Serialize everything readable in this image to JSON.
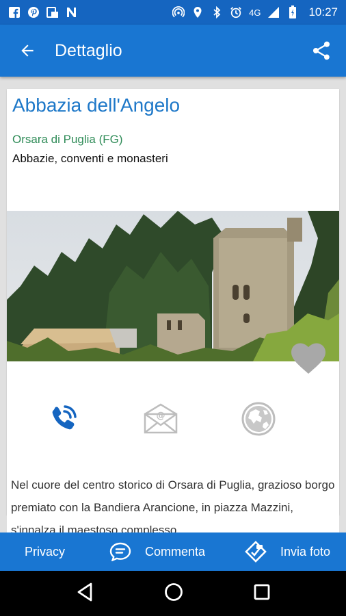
{
  "status_bar": {
    "network": "4G",
    "time": "10:27",
    "icons": [
      "facebook-icon",
      "pinterest-icon",
      "sim-app-icon",
      "n-app-icon",
      "hotspot-icon",
      "location-icon",
      "bluetooth-icon",
      "alarm-icon",
      "signal-icon",
      "battery-icon"
    ]
  },
  "app_bar": {
    "title": "Dettaglio",
    "back_icon": "arrow-back-icon",
    "share_icon": "share-icon"
  },
  "detail": {
    "title": "Abbazia dell'Angelo",
    "location": "Orsara di Puglia (FG)",
    "category": "Abbazie, conventi e monasteri"
  },
  "actions": [
    {
      "icon": "phone-icon",
      "state": "active"
    },
    {
      "icon": "email-icon",
      "state": "inactive"
    },
    {
      "icon": "globe-icon",
      "state": "inactive"
    }
  ],
  "favorite_icon": "heart-icon",
  "description": "Nel cuore del centro storico di Orsara di Puglia, grazioso borgo premiato con la Bandiera Arancione, in piazza Mazzini, s'innalza il maestoso complesso",
  "bottom_bar": {
    "privacy": "Privacy",
    "comment": "Commenta",
    "send_photo": "Invia foto"
  },
  "colors": {
    "primary": "#1976d2",
    "status_bar": "#1565c0",
    "title": "#1e78c8",
    "location": "#2e8b57",
    "inactive_icon": "#bdbdbd"
  }
}
